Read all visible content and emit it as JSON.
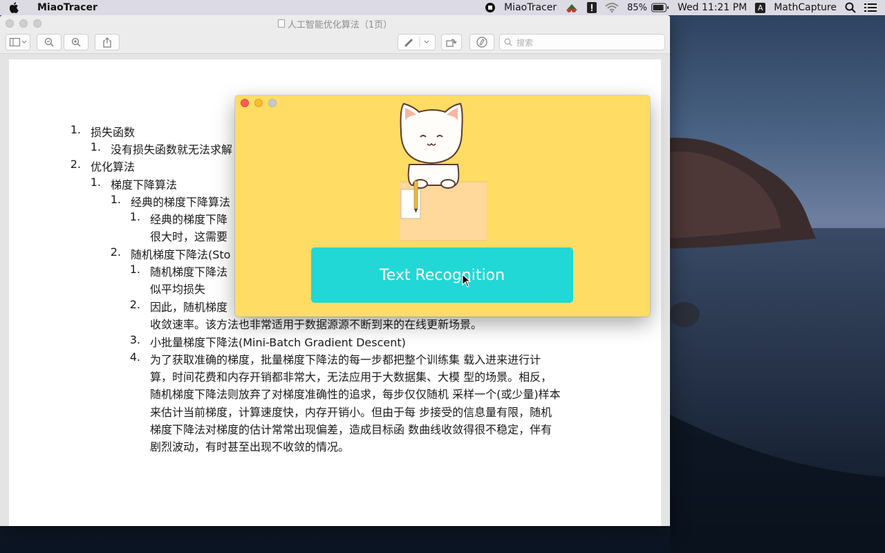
{
  "menubar": {
    "app_name": "MiaoTracer",
    "status_app_name": "MiaoTracer",
    "battery": "85%",
    "clock": "Wed 11:21 PM",
    "input_badge": "A",
    "extra_app": "MathCapture",
    "icons": [
      "apple-icon",
      "screen-record-icon",
      "cherry-app-icon",
      "exclamation-app-icon",
      "wifi-icon",
      "battery-icon",
      "spotlight-icon",
      "control-center-icon"
    ]
  },
  "preview": {
    "title": "人工智能优化算法（1页）",
    "search_placeholder": "搜索",
    "toolbar_icons": [
      "sidebar-icon",
      "zoom-out-icon",
      "zoom-in-icon",
      "share-icon",
      "markup-pen-icon",
      "rotate-icon",
      "annotate-icon"
    ],
    "lines": [
      {
        "num": "1.",
        "text": "损失函数"
      },
      {
        "num": "1.",
        "text": "没有损失函数就无法求解"
      },
      {
        "num": "2.",
        "text": "优化算法"
      },
      {
        "num": "1.",
        "text": "梯度下降算法"
      },
      {
        "num": "1.",
        "text": "经典的梯度下降算法"
      },
      {
        "num": "1.",
        "text": "经典的梯度下降"
      },
      {
        "num": "",
        "text": "很大时，这需要"
      },
      {
        "num": "2.",
        "text": "随机梯度下降法(Sto"
      },
      {
        "num": "1.",
        "text": "随机梯度下降法"
      },
      {
        "num": "",
        "text": "似平均损失"
      },
      {
        "num": "2.",
        "text": "因此，随机梯度"
      },
      {
        "num": "",
        "text": "收敛速率。该方法也非常适用于数据源源不断到来的在线更新场景。"
      },
      {
        "num": "3.",
        "text": "小批量梯度下降法(Mini-Batch Gradient Descent)"
      },
      {
        "num": "4.",
        "text": "为了获取准确的梯度，批量梯度下降法的每一步都把整个训练集 载入进来进行计"
      },
      {
        "num": "",
        "text": "算，时间花费和内存开销都非常大，无法应用于大数据集、大模 型的场景。相反，"
      },
      {
        "num": "",
        "text": "随机梯度下降法则放弃了对梯度准确性的追求，每步仅仅随机 采样一个(或少量)样本"
      },
      {
        "num": "",
        "text": "来估计当前梯度，计算速度快，内存开销小。但由于每 步接受的信息量有限，随机"
      },
      {
        "num": "",
        "text": "梯度下降法对梯度的估计常常出现偏差，造成目标函 数曲线收敛得很不稳定，伴有"
      },
      {
        "num": "",
        "text": "剧烈波动，有时甚至出现不收敛的情况。"
      }
    ]
  },
  "miaotracer": {
    "button_label": "Text Recognition",
    "colors": {
      "window_bg": "#ffdc63",
      "button_bg": "#21d8d6",
      "desk": "#ffd89b"
    }
  }
}
